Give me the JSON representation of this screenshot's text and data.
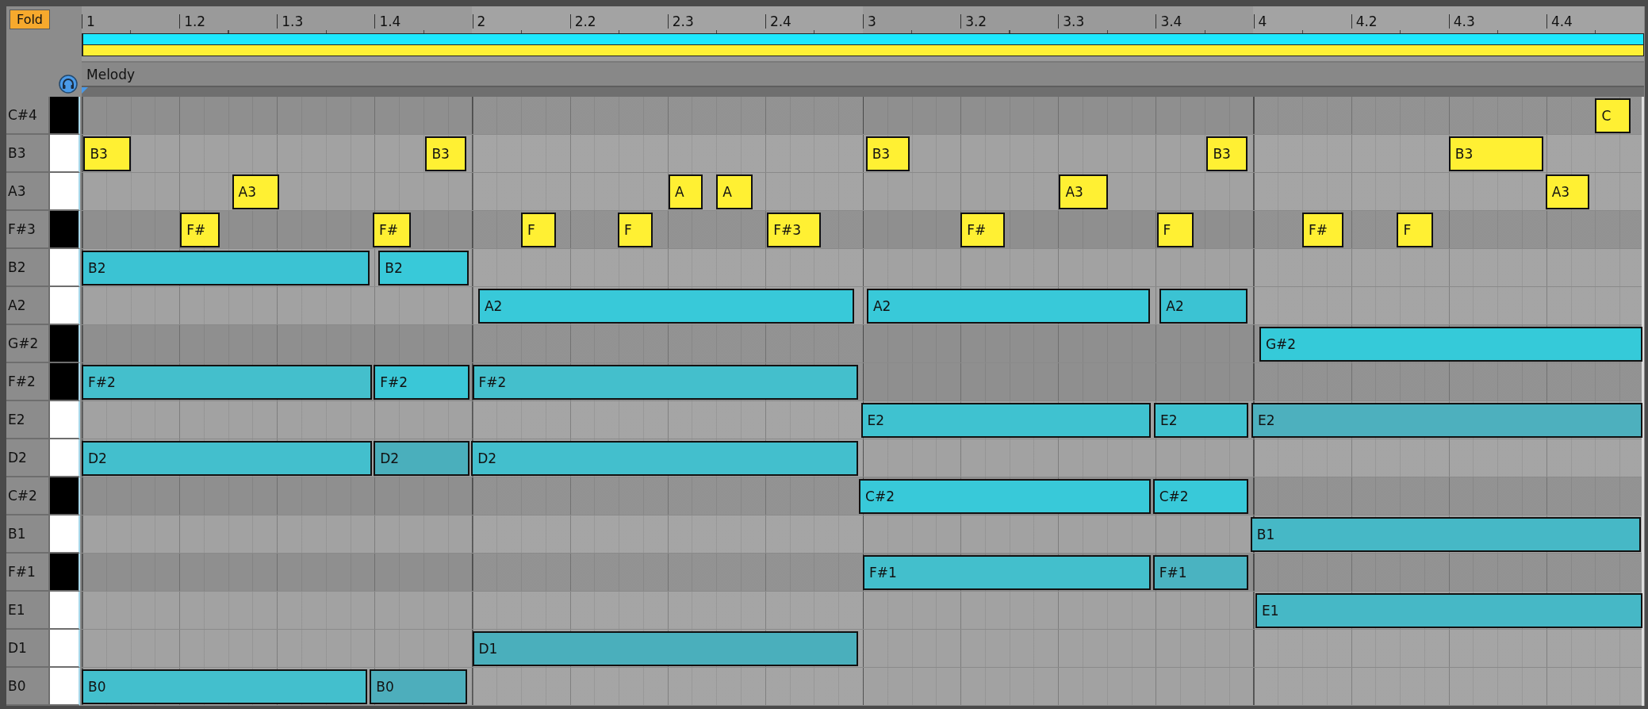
{
  "fold_button": "Fold",
  "ruler": [
    "1",
    "1.2",
    "1.3",
    "1.4",
    "2",
    "2.2",
    "2.3",
    "2.4",
    "3",
    "3.2",
    "3.3",
    "3.4",
    "4",
    "4.2",
    "4.3",
    "4.4"
  ],
  "lane": {
    "label": "Melody"
  },
  "rows": [
    {
      "pitch": "C#4",
      "black": true,
      "notes": [
        {
          "label": "C",
          "color": "#fff033"
        }
      ]
    },
    {
      "pitch": "B3",
      "black": false,
      "notes": [
        {
          "label": "B3",
          "color": "#fff033"
        },
        {
          "label": "B3",
          "color": "#fff033"
        },
        {
          "label": "B3",
          "color": "#fff033"
        },
        {
          "label": "B3",
          "color": "#fff033"
        },
        {
          "label": "B3",
          "color": "#fff033"
        }
      ]
    },
    {
      "pitch": "A3",
      "black": false,
      "notes": [
        {
          "label": "A3",
          "color": "#fff033"
        },
        {
          "label": "A",
          "color": "#fff033"
        },
        {
          "label": "A",
          "color": "#fff033"
        },
        {
          "label": "A3",
          "color": "#fff033"
        },
        {
          "label": "A3",
          "color": "#fff033"
        }
      ]
    },
    {
      "pitch": "F#3",
      "black": true,
      "notes": [
        {
          "label": "F#",
          "color": "#fff033"
        },
        {
          "label": "F#",
          "color": "#fff033"
        },
        {
          "label": "F",
          "color": "#fff033"
        },
        {
          "label": "F",
          "color": "#fff033"
        },
        {
          "label": "F#3",
          "color": "#fff033"
        },
        {
          "label": "F#",
          "color": "#fff033"
        },
        {
          "label": "F",
          "color": "#fff033"
        },
        {
          "label": "F#",
          "color": "#fff033"
        },
        {
          "label": "F",
          "color": "#fff033"
        }
      ]
    },
    {
      "pitch": "B2",
      "black": false,
      "notes": [
        {
          "label": "B2",
          "color": "#3bc3d3"
        },
        {
          "label": "B2",
          "color": "#38c9d9"
        }
      ]
    },
    {
      "pitch": "A2",
      "black": false,
      "notes": [
        {
          "label": "A2",
          "color": "#38c9d9"
        },
        {
          "label": "A2",
          "color": "#38c9d9"
        },
        {
          "label": "A2",
          "color": "#3bc3d3"
        }
      ]
    },
    {
      "pitch": "G#2",
      "black": true,
      "notes": [
        {
          "label": "G#2",
          "color": "#35cad9"
        }
      ]
    },
    {
      "pitch": "F#2",
      "black": true,
      "notes": [
        {
          "label": "F#2",
          "color": "#44bfcc"
        },
        {
          "label": "F#2",
          "color": "#3ac7d7"
        },
        {
          "label": "F#2",
          "color": "#44bfcc"
        }
      ]
    },
    {
      "pitch": "E2",
      "black": false,
      "notes": [
        {
          "label": "E2",
          "color": "#3fc2d0"
        },
        {
          "label": "E2",
          "color": "#3fc2d0"
        },
        {
          "label": "E2",
          "color": "#4db0be"
        }
      ]
    },
    {
      "pitch": "D2",
      "black": false,
      "notes": [
        {
          "label": "D2",
          "color": "#43bfcd"
        },
        {
          "label": "D2",
          "color": "#4aafbc"
        },
        {
          "label": "D2",
          "color": "#43bfcd"
        }
      ]
    },
    {
      "pitch": "C#2",
      "black": true,
      "notes": [
        {
          "label": "C#2",
          "color": "#38c9d9"
        },
        {
          "label": "C#2",
          "color": "#38c9d9"
        }
      ]
    },
    {
      "pitch": "B1",
      "black": false,
      "notes": [
        {
          "label": "B1",
          "color": "#46b8c6"
        }
      ]
    },
    {
      "pitch": "F#1",
      "black": true,
      "notes": [
        {
          "label": "F#1",
          "color": "#43bfcc"
        },
        {
          "label": "F#1",
          "color": "#4ab3c1"
        }
      ]
    },
    {
      "pitch": "E1",
      "black": false,
      "notes": [
        {
          "label": "E1",
          "color": "#46b8c6"
        }
      ]
    },
    {
      "pitch": "D1",
      "black": false,
      "notes": [
        {
          "label": "D1",
          "color": "#4aafbc"
        }
      ]
    },
    {
      "pitch": "B0",
      "black": false,
      "notes": [
        {
          "label": "B0",
          "color": "#43bfcd"
        },
        {
          "label": "B0",
          "color": "#4daebc"
        }
      ]
    }
  ]
}
